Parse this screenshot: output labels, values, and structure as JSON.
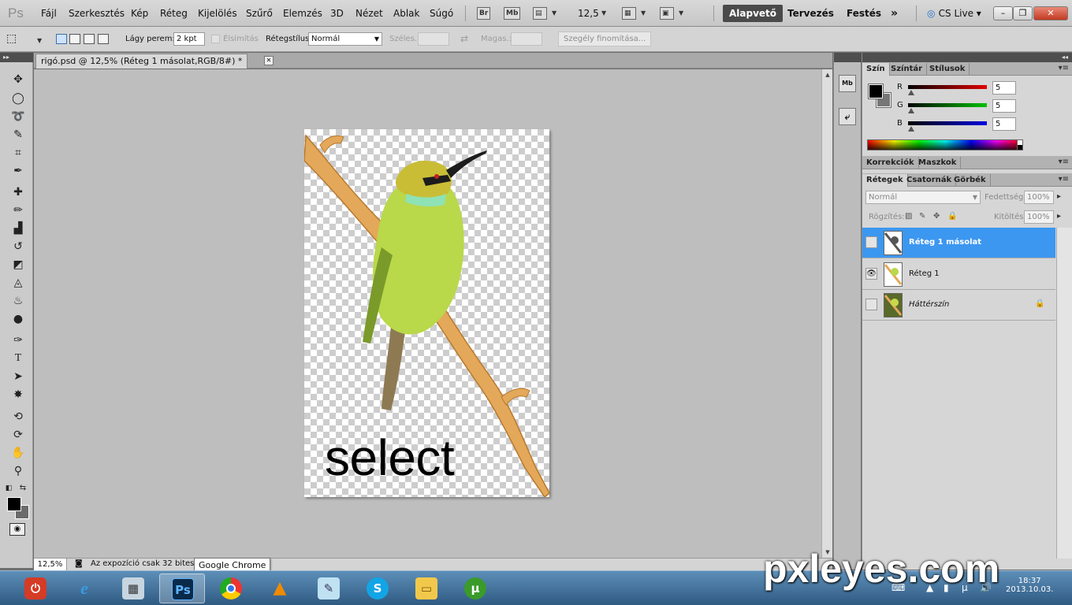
{
  "menubar": {
    "logo": "Ps",
    "items": [
      "Fájl",
      "Szerkesztés",
      "Kép",
      "Réteg",
      "Kijelölés",
      "Szűrő",
      "Elemzés",
      "3D",
      "Nézet",
      "Ablak",
      "Súgó"
    ],
    "bridge_label": "Br",
    "minibridge_label": "Mb",
    "zoom": "12,5",
    "workspaces": [
      "Alapvető",
      "Tervezés",
      "Festés"
    ],
    "more": "»",
    "cslive": "CS Live",
    "window_buttons": [
      "–",
      "❐",
      "✕"
    ]
  },
  "options": {
    "feather_label": "Lágy perem:",
    "feather_value": "2 kpt",
    "antialias_label": "Élsimítás",
    "style_label": "Rétegstílus:",
    "style_value": "Normál",
    "width_label": "Széles.:",
    "height_label": "Magas.:",
    "refine_label": "Szegély finomítása..."
  },
  "document": {
    "tab_title": "rigó.psd @ 12,5% (Réteg 1 másolat,RGB/8#) *",
    "canvas_text": "select"
  },
  "status": {
    "zoom": "12,5%",
    "text": "Az expozíció csak 32 bites kö"
  },
  "tooltip": "Google Chrome",
  "color_panel": {
    "tabs": [
      "Szín",
      "Színtár",
      "Stílusok"
    ],
    "channels": [
      {
        "label": "R",
        "value": "5",
        "color": "#e00000"
      },
      {
        "label": "G",
        "value": "5",
        "color": "#00c000"
      },
      {
        "label": "B",
        "value": "5",
        "color": "#0000e0"
      }
    ]
  },
  "adjust_panel": {
    "tabs": [
      "Korrekciók",
      "Maszkok"
    ]
  },
  "layers_panel": {
    "tabs": [
      "Rétegek",
      "Csatornák",
      "Görbék"
    ],
    "blend_mode": "Normál",
    "opacity_label": "Fedettség:",
    "opacity_value": "100%",
    "lock_label": "Rögzítés:",
    "fill_label": "Kitöltés:",
    "fill_value": "100%",
    "layers": [
      {
        "name": "Réteg 1 másolat",
        "selected": true,
        "visible": false
      },
      {
        "name": "Réteg 1",
        "selected": false,
        "visible": true
      },
      {
        "name": "Háttérszín",
        "selected": false,
        "visible": false,
        "locked": true
      }
    ]
  },
  "taskbar": {
    "photoshop_label": "Ps",
    "clock_time": "18:37",
    "clock_date": "2013.10.03."
  },
  "watermark": "pxleyes.com",
  "colors": {
    "selection_blue": "#3c97f0",
    "menubar_bg": "#d9d9d9",
    "workspace_bg": "#bebebe"
  }
}
